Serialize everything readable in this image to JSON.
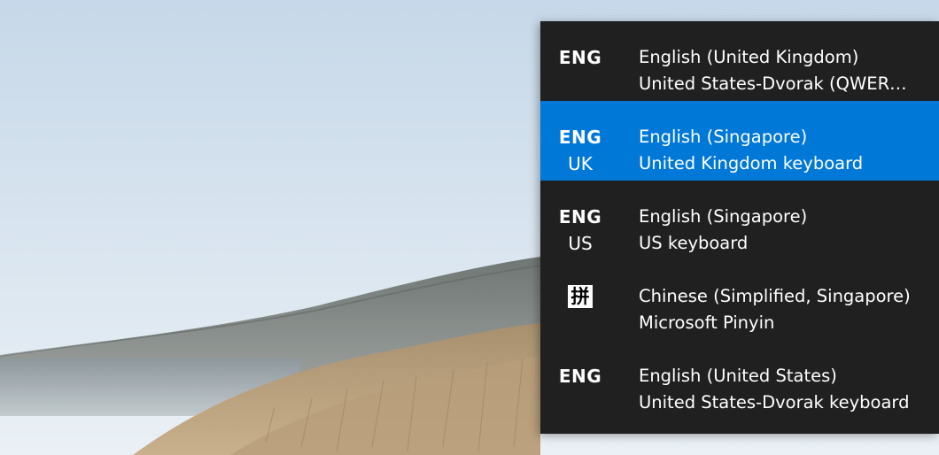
{
  "wallpaper": {
    "sky_top": "#c9dbea",
    "sky_bottom": "#e9eff4",
    "hill_color": "#7f8582",
    "grass_color": "#b49a78",
    "water_color": "#aeb7bd"
  },
  "flyout": {
    "background": "#202020",
    "selected_background": "#0078d7",
    "items": [
      {
        "abbr": "ENG",
        "layout_abbr": "",
        "language": "English (United Kingdom)",
        "keyboard": "United States-Dvorak (QWER…",
        "selected": false
      },
      {
        "abbr": "ENG",
        "layout_abbr": "UK",
        "language": "English (Singapore)",
        "keyboard": "United Kingdom keyboard",
        "selected": true
      },
      {
        "abbr": "ENG",
        "layout_abbr": "US",
        "language": "English (Singapore)",
        "keyboard": "US keyboard",
        "selected": false
      },
      {
        "abbr": "拼",
        "layout_abbr": "",
        "language": "Chinese (Simplified, Singapore)",
        "keyboard": "Microsoft Pinyin",
        "selected": false,
        "icon": "pinyin-ime-icon"
      },
      {
        "abbr": "ENG",
        "layout_abbr": "",
        "language": "English (United States)",
        "keyboard": "United States-Dvorak keyboard",
        "selected": false
      }
    ]
  }
}
